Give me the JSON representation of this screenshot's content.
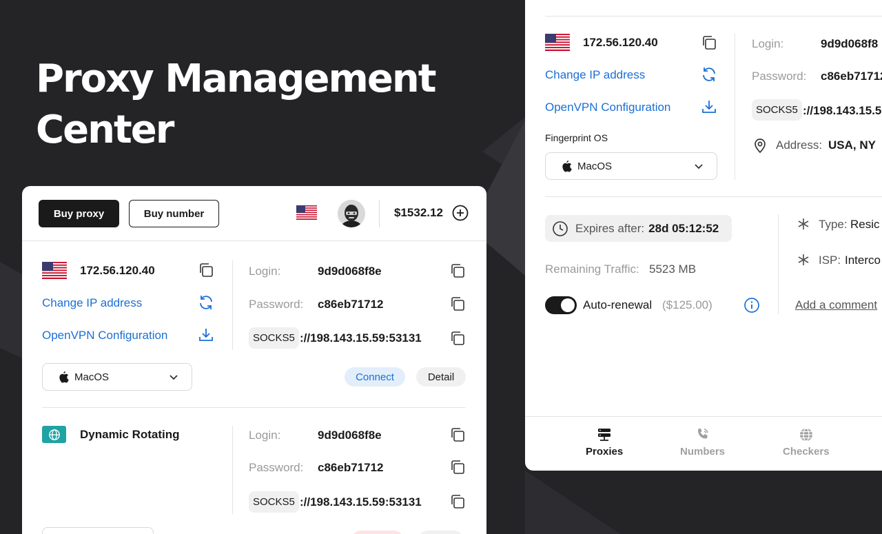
{
  "hero": {
    "title": "Proxy Management Center"
  },
  "left_panel": {
    "header": {
      "buy_proxy": "Buy proxy",
      "buy_number": "Buy number",
      "balance": "$1532.12"
    },
    "proxy1": {
      "ip": "172.56.120.40",
      "change_ip": "Change IP address",
      "openvpn": "OpenVPN Configuration",
      "login_label": "Login:",
      "login_value": "9d9d068f8e",
      "password_label": "Password:",
      "password_value": "c86eb71712",
      "protocol": "SOCKS5",
      "address": "://198.143.15.59:53131",
      "os": "MacOS",
      "connect": "Connect",
      "detail": "Detail"
    },
    "proxy2": {
      "name": "Dynamic Rotating",
      "login_label": "Login:",
      "login_value": "9d9d068f8e",
      "password_label": "Password:",
      "password_value": "c86eb71712",
      "protocol": "SOCKS5",
      "address": "://198.143.15.59:53131"
    }
  },
  "right_panel": {
    "ip": "172.56.120.40",
    "change_ip": "Change IP address",
    "openvpn": "OpenVPN Configuration",
    "fingerprint_label": "Fingerprint OS",
    "os": "MacOS",
    "login_label": "Login:",
    "login_value": "9d9d068f8",
    "password_label": "Password:",
    "password_value": "c86eb71712",
    "protocol": "SOCKS5",
    "address": "://198.143.15.5",
    "location_label": "Address:",
    "location_value": "USA, NY",
    "expires_label": "Expires after:",
    "expires_value": "28d 05:12:52",
    "traffic_label": "Remaining Traffic:",
    "traffic_value": "5523 MB",
    "auto_renewal_label": "Auto-renewal",
    "auto_renewal_price": "($125.00)",
    "type_label": "Type:",
    "type_value": "Resic",
    "isp_label": "ISP:",
    "isp_value": "Interco",
    "add_comment": "Add a comment",
    "nav": {
      "proxies": "Proxies",
      "numbers": "Numbers",
      "checkers": "Checkers"
    }
  },
  "colors": {
    "accent_blue": "#1a6fd6",
    "teal": "#1fa3a3",
    "dark": "#1a1a1a",
    "background": "#242427"
  },
  "icons": [
    "copy-icon",
    "refresh-icon",
    "download-icon",
    "apple-icon",
    "chevron-down-icon",
    "plus-circle-icon",
    "globe-icon",
    "clock-icon",
    "info-icon",
    "location-pin-icon",
    "asterisk-icon",
    "server-icon",
    "phone-icon"
  ]
}
